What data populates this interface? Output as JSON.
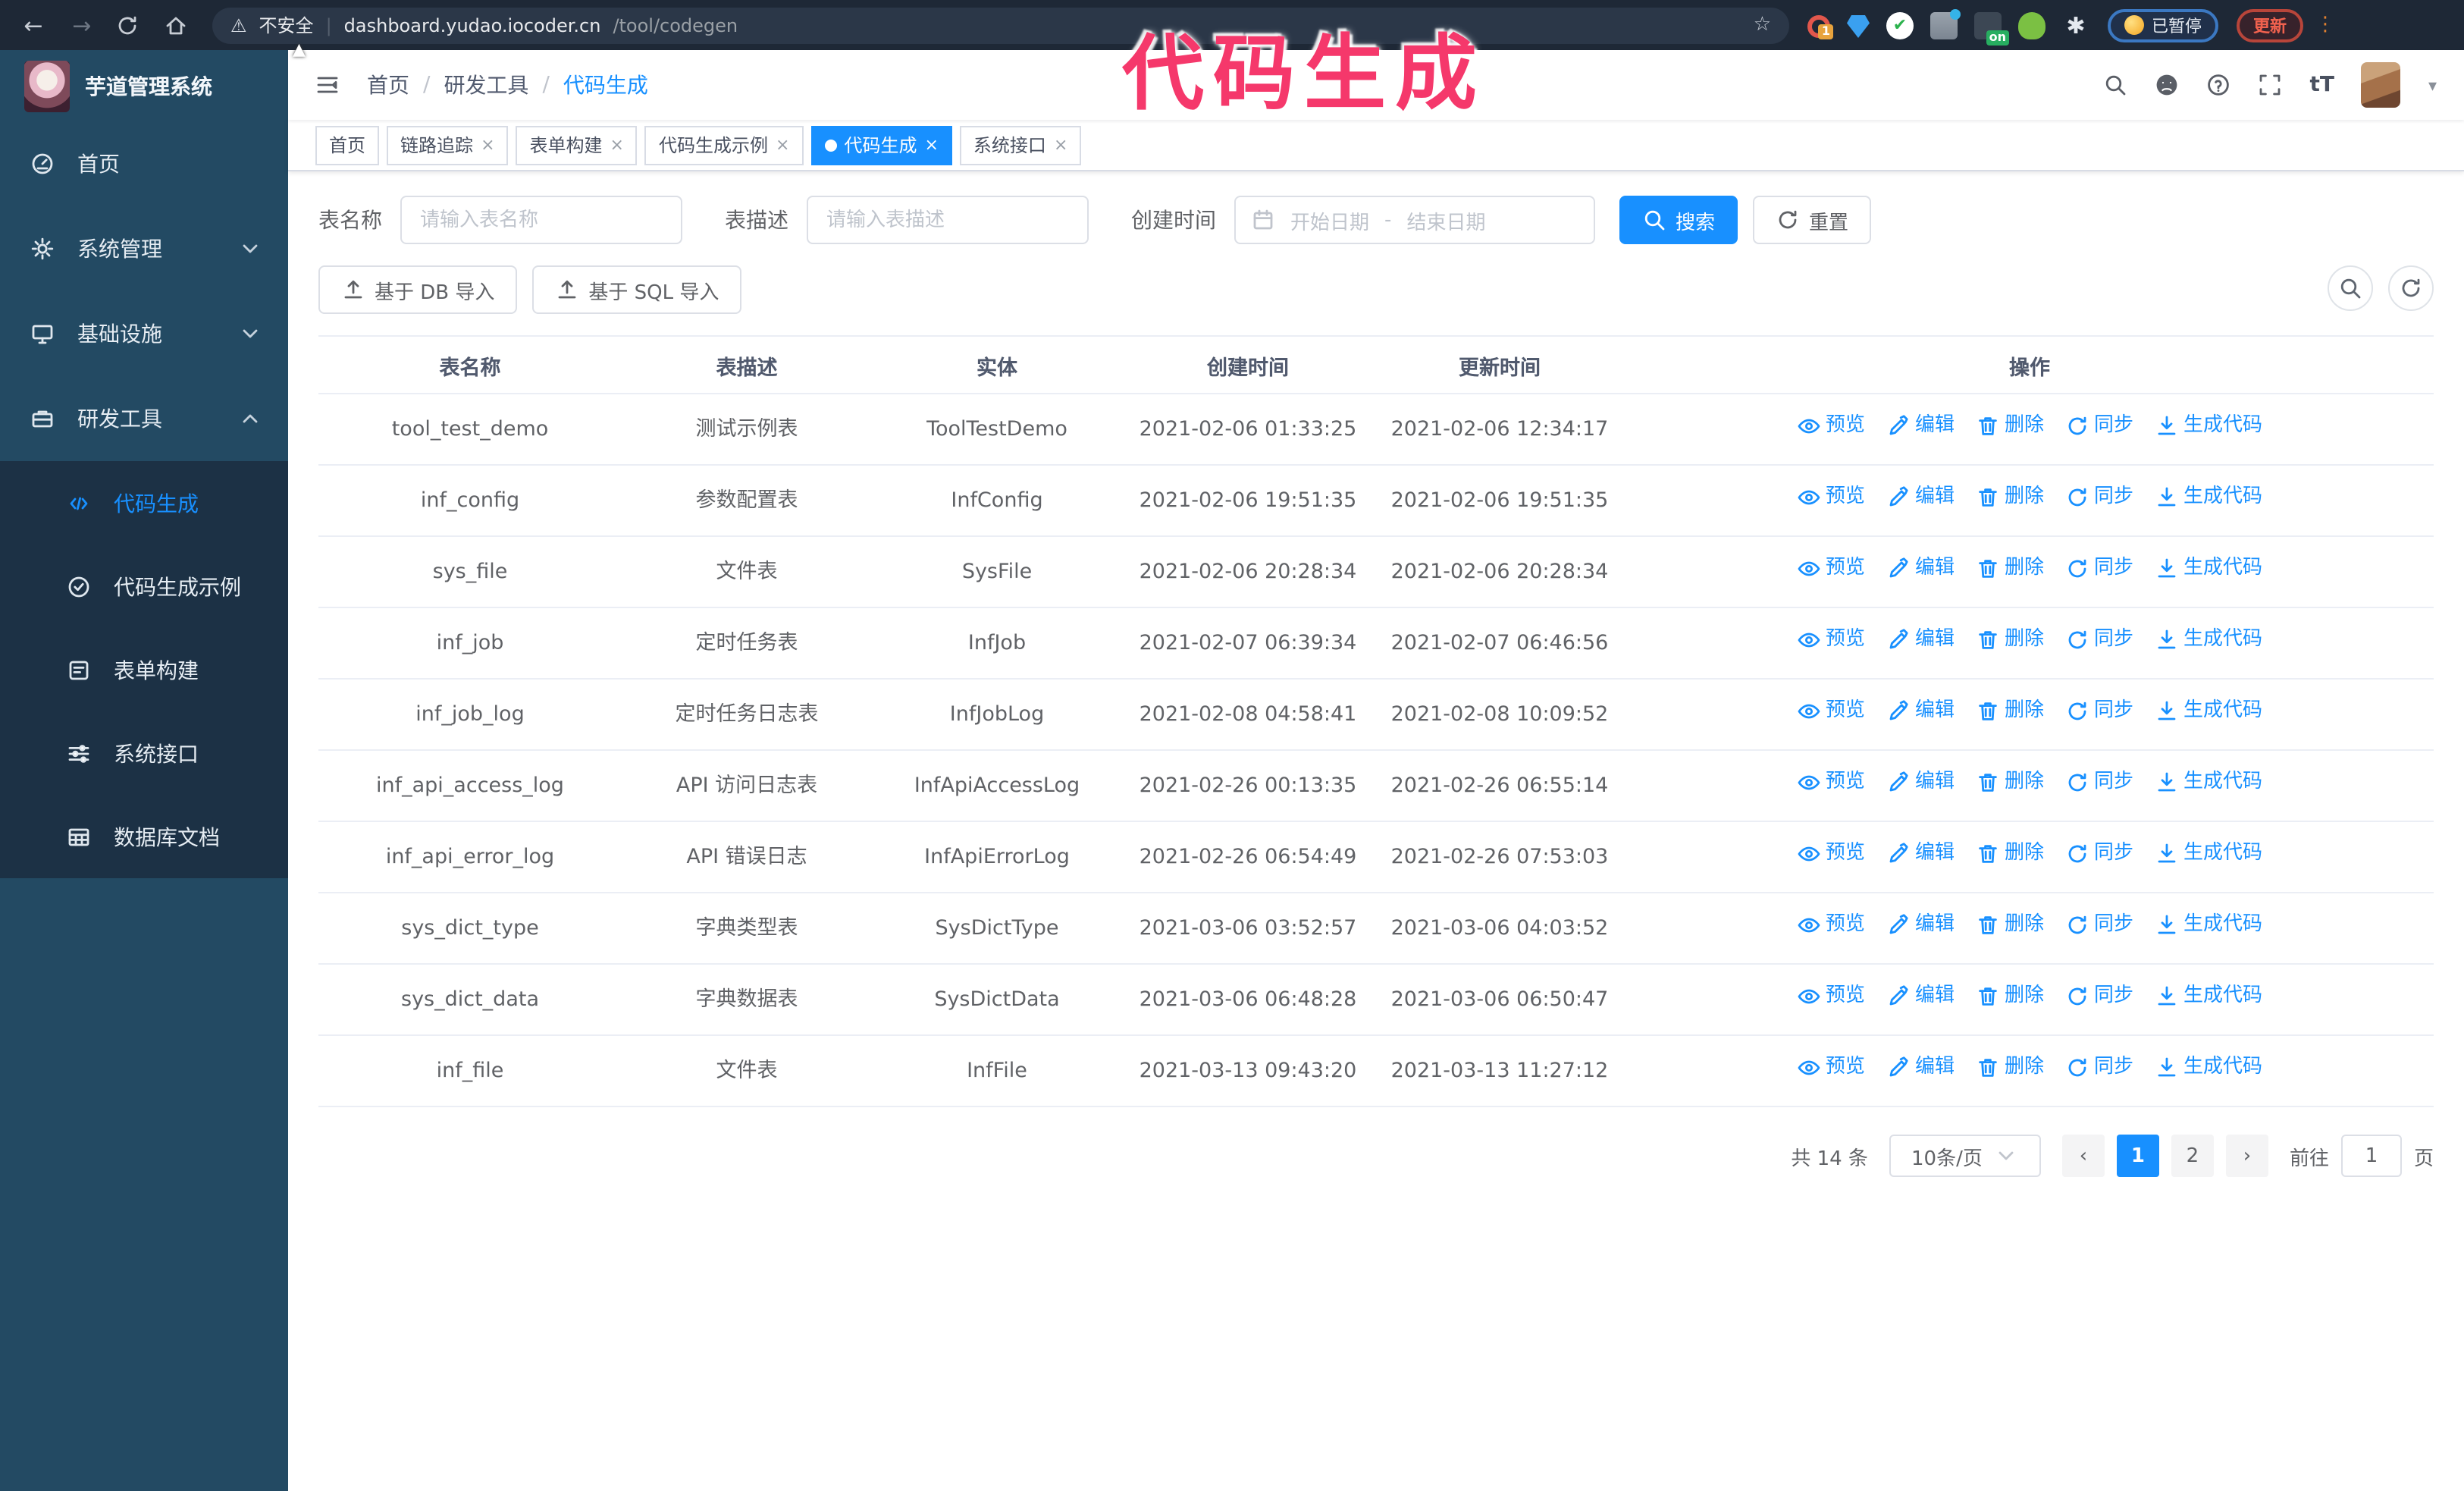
{
  "annotation": {
    "text": "代码生成",
    "color": "#f5386b"
  },
  "browser": {
    "insecure_label": "不安全",
    "url_domain": "dashboard.yudao.iocoder.cn",
    "url_path": "/tool/codegen",
    "paused_badge": "已暂停",
    "update_button": "更新",
    "extensions": [
      {
        "name": "ext-sync-icon",
        "badge": "1"
      },
      {
        "name": "ext-gem-icon"
      },
      {
        "name": "ext-shield-icon"
      },
      {
        "name": "ext-stats-icon"
      },
      {
        "name": "ext-screen-icon",
        "badge": "on",
        "badge_color": "green"
      },
      {
        "name": "ext-monkey-icon"
      },
      {
        "name": "ext-puzzle-icon"
      }
    ]
  },
  "app": {
    "title": "芋道管理系统"
  },
  "breadcrumb": {
    "separator": "/",
    "items": [
      "首页",
      "研发工具",
      "代码生成"
    ]
  },
  "sidebar": {
    "items": [
      {
        "label": "首页",
        "icon": "gauge-icon"
      },
      {
        "label": "系统管理",
        "icon": "gear-icon",
        "chevron": "down"
      },
      {
        "label": "基础设施",
        "icon": "monitor-icon",
        "chevron": "down"
      },
      {
        "label": "研发工具",
        "icon": "toolbox-icon",
        "chevron": "up",
        "expanded": true,
        "children": [
          {
            "label": "代码生成",
            "icon": "code-icon",
            "active": true
          },
          {
            "label": "代码生成示例",
            "icon": "badge-check-icon"
          },
          {
            "label": "表单构建",
            "icon": "form-icon"
          },
          {
            "label": "系统接口",
            "icon": "sliders-icon"
          },
          {
            "label": "数据库文档",
            "icon": "db-table-icon"
          }
        ]
      }
    ]
  },
  "tabs": [
    {
      "label": "首页",
      "closable": false,
      "active": false
    },
    {
      "label": "链路追踪",
      "closable": true,
      "active": false
    },
    {
      "label": "表单构建",
      "closable": true,
      "active": false
    },
    {
      "label": "代码生成示例",
      "closable": true,
      "active": false
    },
    {
      "label": "代码生成",
      "closable": true,
      "active": true
    },
    {
      "label": "系统接口",
      "closable": true,
      "active": false
    }
  ],
  "filters": {
    "name_label": "表名称",
    "name_placeholder": "请输入表名称",
    "desc_label": "表描述",
    "desc_placeholder": "请输入表描述",
    "time_label": "创建时间",
    "start_placeholder": "开始日期",
    "range_separator": "-",
    "end_placeholder": "结束日期",
    "search_label": "搜索",
    "reset_label": "重置"
  },
  "toolbar": {
    "db_import_label": "基于 DB 导入",
    "sql_import_label": "基于 SQL 导入"
  },
  "table": {
    "columns": [
      "表名称",
      "表描述",
      "实体",
      "创建时间",
      "更新时间",
      "操作"
    ],
    "actions": [
      {
        "label": "预览",
        "icon": "eye-icon"
      },
      {
        "label": "编辑",
        "icon": "edit-icon"
      },
      {
        "label": "删除",
        "icon": "delete-icon"
      },
      {
        "label": "同步",
        "icon": "sync-icon"
      },
      {
        "label": "生成代码",
        "icon": "download-icon"
      }
    ],
    "rows": [
      {
        "name": "tool_test_demo",
        "desc": "测试示例表",
        "entity": "ToolTestDemo",
        "created": "2021-02-06 01:33:25",
        "updated": "2021-02-06 12:34:17"
      },
      {
        "name": "inf_config",
        "desc": "参数配置表",
        "entity": "InfConfig",
        "created": "2021-02-06 19:51:35",
        "updated": "2021-02-06 19:51:35"
      },
      {
        "name": "sys_file",
        "desc": "文件表",
        "entity": "SysFile",
        "created": "2021-02-06 20:28:34",
        "updated": "2021-02-06 20:28:34"
      },
      {
        "name": "inf_job",
        "desc": "定时任务表",
        "entity": "InfJob",
        "created": "2021-02-07 06:39:34",
        "updated": "2021-02-07 06:46:56"
      },
      {
        "name": "inf_job_log",
        "desc": "定时任务日志表",
        "entity": "InfJobLog",
        "created": "2021-02-08 04:58:41",
        "updated": "2021-02-08 10:09:52"
      },
      {
        "name": "inf_api_access_log",
        "desc": "API 访问日志表",
        "entity": "InfApiAccessLog",
        "created": "2021-02-26 00:13:35",
        "updated": "2021-02-26 06:55:14"
      },
      {
        "name": "inf_api_error_log",
        "desc": "API 错误日志",
        "entity": "InfApiErrorLog",
        "created": "2021-02-26 06:54:49",
        "updated": "2021-02-26 07:53:03"
      },
      {
        "name": "sys_dict_type",
        "desc": "字典类型表",
        "entity": "SysDictType",
        "created": "2021-03-06 03:52:57",
        "updated": "2021-03-06 04:03:52"
      },
      {
        "name": "sys_dict_data",
        "desc": "字典数据表",
        "entity": "SysDictData",
        "created": "2021-03-06 06:48:28",
        "updated": "2021-03-06 06:50:47"
      },
      {
        "name": "inf_file",
        "desc": "文件表",
        "entity": "InfFile",
        "created": "2021-03-13 09:43:20",
        "updated": "2021-03-13 11:27:12"
      }
    ]
  },
  "pagination": {
    "total": "共 14 条",
    "page_size": "10条/页",
    "pages": [
      "1",
      "2"
    ],
    "active_page": "1",
    "prev": "‹",
    "next": "›",
    "jumper_prefix": "前往",
    "jumper_value": "1",
    "jumper_suffix": "页"
  },
  "header_icons": {
    "textsize_glyph": "tT"
  },
  "colors": {
    "accent": "#1890ff",
    "sidebar_bg": "#234a63",
    "submenu_bg": "#1c3145",
    "chrome_bg": "#1e2836",
    "annotation_pink": "#f5386b",
    "table_border": "#ebeef5"
  }
}
